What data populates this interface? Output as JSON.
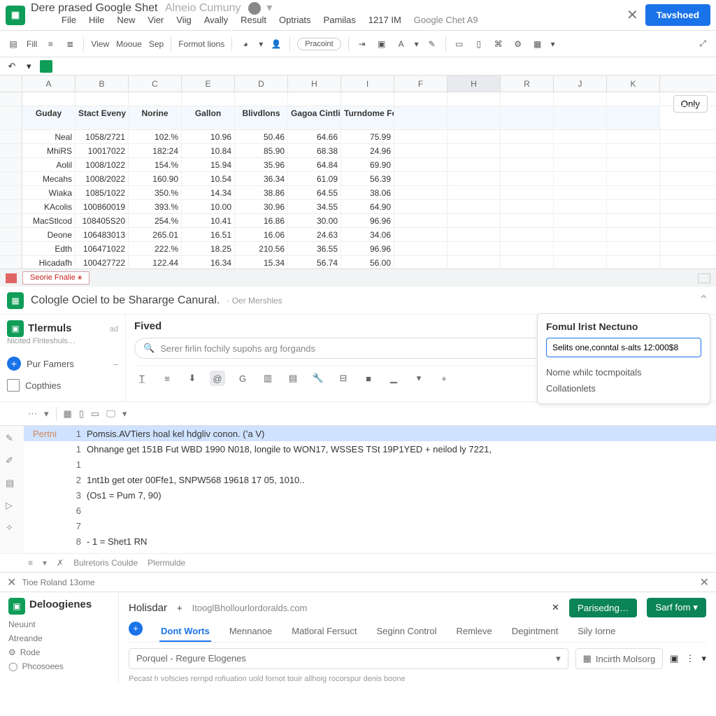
{
  "titlebar": {
    "doc_title": "Dere prased Google Shet",
    "doc_subtitle": "Alneio Cumuny",
    "share_btn": "Tavshoed"
  },
  "menubar": [
    "File",
    "Hile",
    "New",
    "Vier",
    "Viig",
    "Avally",
    "Result",
    "Optriats",
    "Pamilas",
    "1217 IM",
    "Google Chet A9"
  ],
  "toolbar": {
    "fill": "Fill",
    "view": "View",
    "mooue": "Mooue",
    "sep": "Sep",
    "format": "Formot lions",
    "pracoint": "Pracoint"
  },
  "only_btn": "Only",
  "columns": [
    "A",
    "B",
    "C",
    "E",
    "D",
    "H",
    "I",
    "F",
    "H",
    "R",
    "J",
    "K"
  ],
  "table": {
    "headers": [
      "Guday",
      "Stact Eveny",
      "Norine",
      "Gallon",
      "Blivdlons",
      "Gagoa Cintliay",
      "Turndome Formulals"
    ],
    "rows": [
      [
        "Neal",
        "1058/2721",
        "102.%",
        "10.96",
        "50.46",
        "64.66",
        "75.99"
      ],
      [
        "MhiRS",
        "10017022",
        "182:24",
        "10.84",
        "85.90",
        "68.38",
        "24.96"
      ],
      [
        "Aolil",
        "1008/1022",
        "154.%",
        "15.94",
        "35.96",
        "64.84",
        "69.90"
      ],
      [
        "Mecahs",
        "1008/2022",
        "160.90",
        "10.54",
        "36.34",
        "61.09",
        "56.39"
      ],
      [
        "Wiaka",
        "1085/1022",
        "350.%",
        "14.34",
        "38.86",
        "64.55",
        "38.06"
      ],
      [
        "KAcolis",
        "100860019",
        "393.%",
        "10.00",
        "30.96",
        "34.55",
        "64.90"
      ],
      [
        "MacStlcod",
        "108405S20",
        "254.%",
        "10.41",
        "16.86",
        "30.00",
        "96.96"
      ],
      [
        "Deone",
        "106483013",
        "265.01",
        "16.51",
        "16.06",
        "24.63",
        "34.06"
      ],
      [
        "Edth",
        "106471022",
        "222.%",
        "18.25",
        "210.56",
        "36.55",
        "96.96"
      ],
      [
        "Hicadafh",
        "100427722",
        "122.44",
        "16.34",
        "15.34",
        "56.74",
        "56.00"
      ]
    ]
  },
  "sheet_tab": "Seorie Fnalie ⚹",
  "panel": {
    "title": "Cologle Ociel to be Shararge Canural.",
    "sub": "· Oer Mershles",
    "left_title": "Tlermuls",
    "left_ad": "ad",
    "left_sub": "Nicited Flriteshuls…",
    "pur": "Pur Famers",
    "copthies": "Copthies",
    "fived": "Fived",
    "search_ph": "Serer firlin fochily supohs arg forgands"
  },
  "popup": {
    "title": "Fomul lrist Nectuno",
    "input": "Selits one,conntal s-alts 12:000$8",
    "opt1": "Nome whilc tocmpoitals",
    "opt2": "Collationlets"
  },
  "code": {
    "gutter_label": "Pertni",
    "lines": [
      {
        "n": "1",
        "t": "Pomsis.AVTiers hoal kel hdgliv conon. (’a V)"
      },
      {
        "n": "1",
        "t": "Ohnange get 151B Fut WBD 1990 N018, longile to WON17, WSSES TSt 19P1YED + neilod ly 7221,"
      },
      {
        "n": "1",
        "t": ""
      },
      {
        "n": "2",
        "t": "1nt1b get oter 00Ffe1, SNPW568 19618 17 05, 1010.."
      },
      {
        "n": "3",
        "t": "(Os1 = Pum 7, 90)"
      },
      {
        "n": "6",
        "t": ""
      },
      {
        "n": "7",
        "t": ""
      },
      {
        "n": "8",
        "t": "- 1 = Shet1 RN"
      }
    ],
    "status1": "Bulretoris Coulde",
    "status2": "Plermulde"
  },
  "btm_bar": "Tioe Roland 13ome",
  "bottom": {
    "title": "Deloogienes",
    "nav": [
      "Neuunt",
      "Atreande",
      "Rode",
      "Phcosoees"
    ],
    "tab": "Holisdar",
    "url": "ItooglBhollourlordoralds.com",
    "btn1": "Parisedng…",
    "btn2": "Sarf fom",
    "subtabs": [
      "Dont Worts",
      "Mennanoe",
      "Matloral Fersuct",
      "Seginn Control",
      "Remleve",
      "Degintment",
      "Sily Iorne"
    ],
    "addr": "Porquel - Regure Elogenes",
    "chip": "Incirth Molsorg",
    "footer": "Pecast h vofscies rernpd rofiuation uold fornot touir allhoig rocorspur denis boone"
  }
}
